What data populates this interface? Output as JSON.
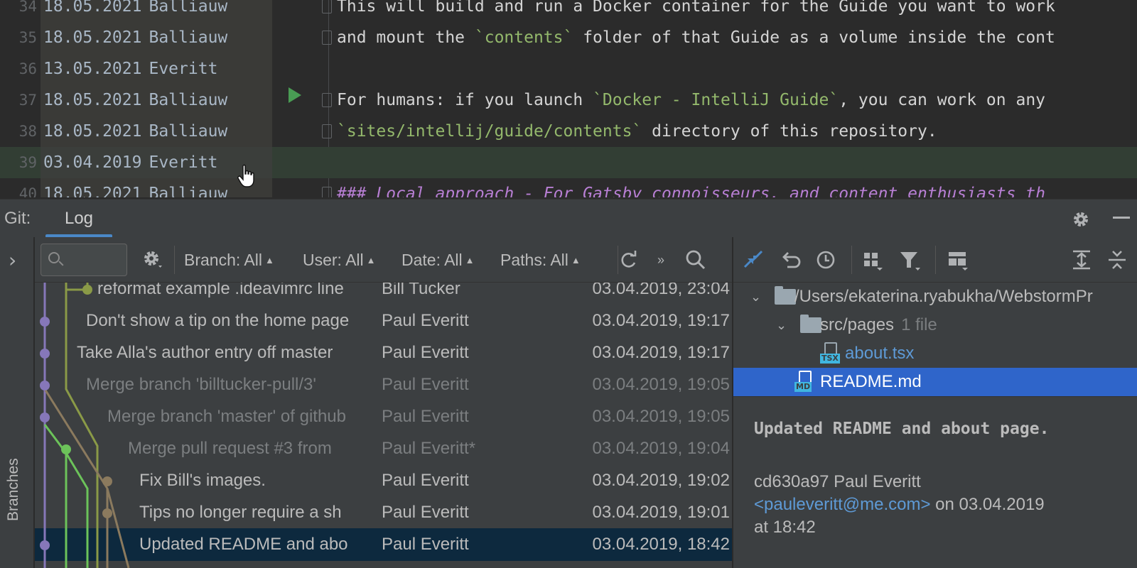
{
  "editor": {
    "lines": [
      {
        "num": "34",
        "date": "18.05.2021",
        "author": "Balliauw",
        "code": [
          {
            "t": "This will build and run a Docker container for the Guide you want to work",
            "c": ""
          }
        ]
      },
      {
        "num": "35",
        "date": "18.05.2021",
        "author": "Balliauw",
        "code": [
          {
            "t": "and mount the ",
            "c": ""
          },
          {
            "t": "`contents`",
            "c": "str"
          },
          {
            "t": " folder of that Guide as a volume inside the cont",
            "c": ""
          }
        ]
      },
      {
        "num": "36",
        "date": "13.05.2021",
        "author": "Everitt",
        "code": []
      },
      {
        "num": "37",
        "date": "18.05.2021",
        "author": "Balliauw",
        "code": [
          {
            "t": "For humans: if you launch ",
            "c": ""
          },
          {
            "t": "`Docker - IntelliJ Guide`",
            "c": "str"
          },
          {
            "t": ", you can work on any",
            "c": ""
          }
        ]
      },
      {
        "num": "38",
        "date": "18.05.2021",
        "author": "Balliauw",
        "code": [
          {
            "t": "`sites/intellij/guide/contents`",
            "c": "str"
          },
          {
            "t": " directory of this repository.",
            "c": ""
          }
        ]
      },
      {
        "num": "39",
        "date": "03.04.2019",
        "author": "Everitt",
        "code": []
      },
      {
        "num": "40",
        "date": "18.05.2021",
        "author": "Balliauw",
        "code": [
          {
            "t": "### Local approach - For Gatsby connoisseurs, and content enthusiasts th",
            "c": "hd"
          }
        ]
      }
    ]
  },
  "git": {
    "title": "Git:",
    "tab": "Log",
    "branches_label": "Branches",
    "search_placeholder": "",
    "filters": {
      "branch": "Branch: All",
      "user": "User: All",
      "date": "Date: All",
      "paths": "Paths: All"
    },
    "commits": [
      {
        "msg": "reformat example .ideavimrc line",
        "author": "Bill Tucker",
        "date": "03.04.2019, 23:04",
        "dim": false
      },
      {
        "msg": "Don't show a tip on the home page",
        "author": "Paul Everitt",
        "date": "03.04.2019, 19:17",
        "dim": false
      },
      {
        "msg": "Take Alla's author entry off master",
        "author": "Paul Everitt",
        "date": "03.04.2019, 19:17",
        "dim": false
      },
      {
        "msg": "Merge branch 'billtucker-pull/3'",
        "author": "Paul Everitt",
        "date": "03.04.2019, 19:05",
        "dim": true
      },
      {
        "msg": "Merge branch 'master' of github",
        "author": "Paul Everitt",
        "date": "03.04.2019, 19:05",
        "dim": true
      },
      {
        "msg": "Merge pull request #3 from",
        "author": "Paul Everitt*",
        "date": "03.04.2019, 19:04",
        "dim": true
      },
      {
        "msg": "Fix Bill's images.",
        "author": "Paul Everitt",
        "date": "03.04.2019, 19:02",
        "dim": false
      },
      {
        "msg": "Tips no longer require a sh",
        "author": "Paul Everitt",
        "date": "03.04.2019, 19:01",
        "dim": false
      },
      {
        "msg": "Updated README and abo",
        "author": "Paul Everitt",
        "date": "03.04.2019, 18:42",
        "dim": false
      }
    ],
    "tree": {
      "root": "/Users/ekaterina.ryabukha/WebstormPr",
      "folder": "src/pages",
      "folder_count": "1 file",
      "file1": "about.tsx",
      "file1_tag": "TSX",
      "file2": "README.md",
      "file2_tag": "MD"
    },
    "detail": {
      "title": "Updated README and about page.",
      "hash_author": "cd630a97 Paul Everitt",
      "email": "<pauleveritt@me.com>",
      "on": " on 03.04.2019",
      "at": "at 18:42"
    }
  },
  "colors": {
    "accent": "#4a88c7",
    "selection": "#2f65ca",
    "graph_purple": "#8677b9",
    "graph_olive": "#8a9a47",
    "graph_green": "#6cc35a",
    "graph_brown": "#8b7a5e"
  }
}
